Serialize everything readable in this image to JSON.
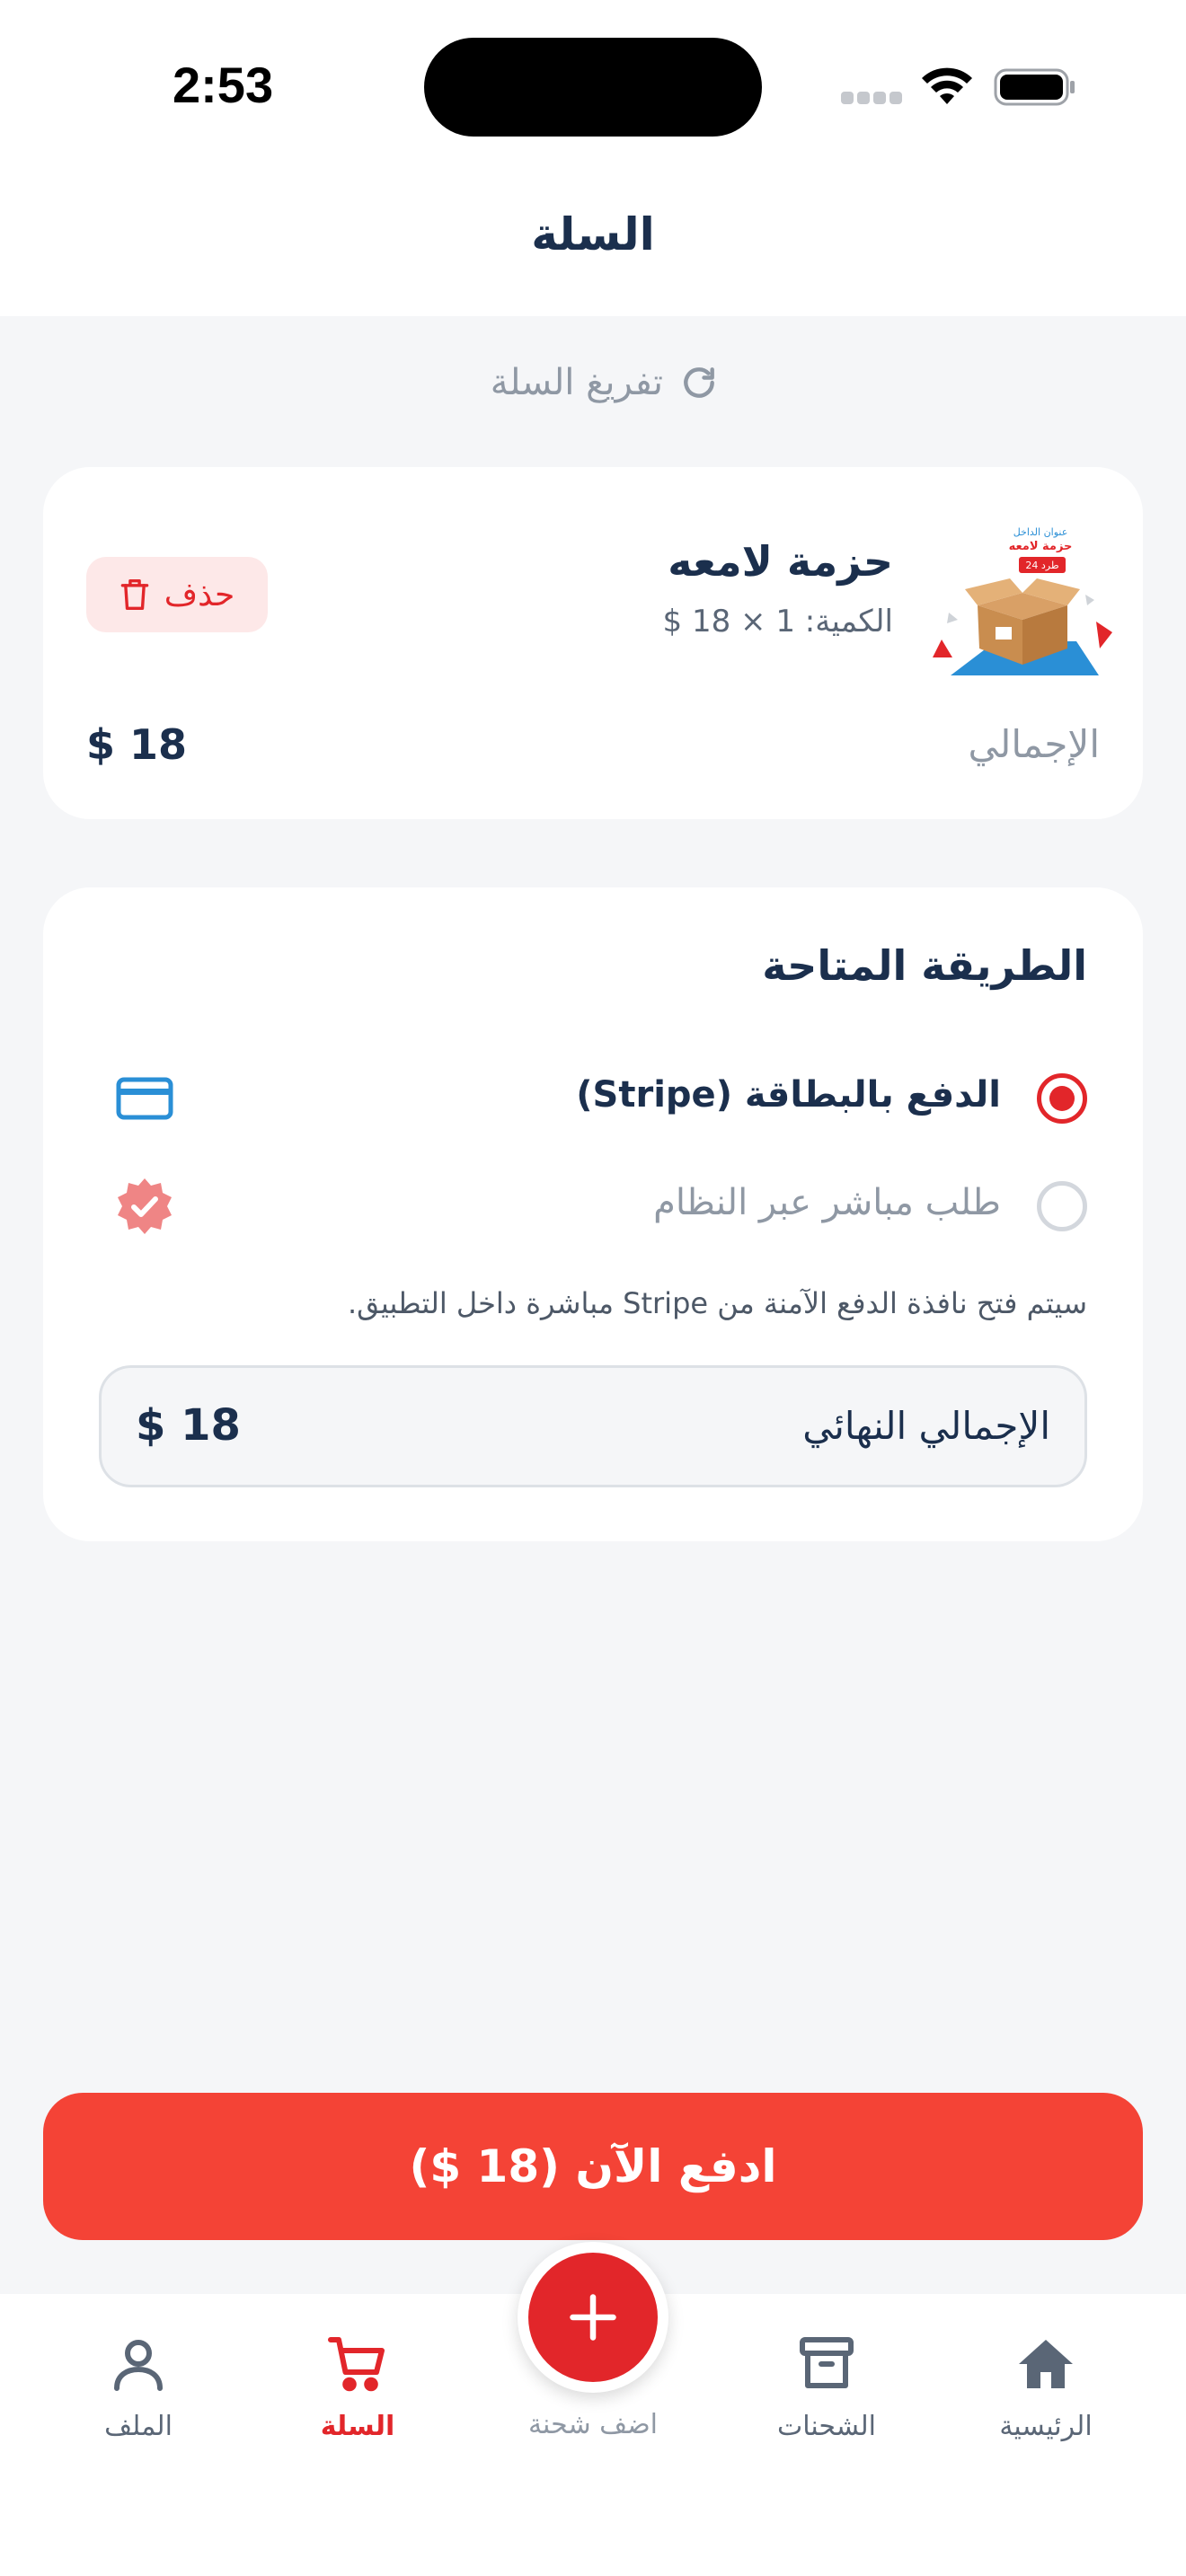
{
  "status_bar": {
    "time": "2:53"
  },
  "header": {
    "title": "السلة"
  },
  "cart": {
    "clear_label": "تفريغ السلة"
  },
  "item": {
    "name": "حزمة لامعه",
    "quantity": "الكمية: 1 × 18 $",
    "delete_label": "حذف",
    "total_label": "الإجمالي",
    "total_value": "18 $",
    "thumb_text_top": "عنوان الداخل",
    "thumb_text_name": "حزمة لامعه",
    "thumb_badge": "24 طرد"
  },
  "payment": {
    "title": "الطريقة المتاحة",
    "methods": [
      {
        "label": "الدفع بالبطاقة (Stripe)",
        "selected": true,
        "icon": "credit-card-icon"
      },
      {
        "label": "طلب مباشر عبر النظام",
        "selected": false,
        "icon": "verified-badge-icon"
      }
    ],
    "note": "سيتم فتح نافذة الدفع الآمنة من Stripe مباشرة داخل التطبيق.",
    "final_label": "الإجمالي النهائي",
    "final_value": "18 $"
  },
  "pay_button": {
    "label": "ادفع الآن (18 $)"
  },
  "nav": {
    "items": [
      {
        "label": "الرئيسية",
        "icon": "home-icon"
      },
      {
        "label": "الشحنات",
        "icon": "archive-icon"
      },
      {
        "label": "اضف شحنة",
        "icon": "plus-icon"
      },
      {
        "label": "السلة",
        "icon": "cart-icon",
        "active": true
      },
      {
        "label": "الملف",
        "icon": "user-icon"
      }
    ]
  },
  "colors": {
    "accent": "#e2262a",
    "pay_button": "#f44336",
    "text_dark": "#1b2f4d",
    "text_muted": "#8f98a4",
    "background": "#f5f6f8",
    "card_icon_blue": "#2a8fd6"
  }
}
